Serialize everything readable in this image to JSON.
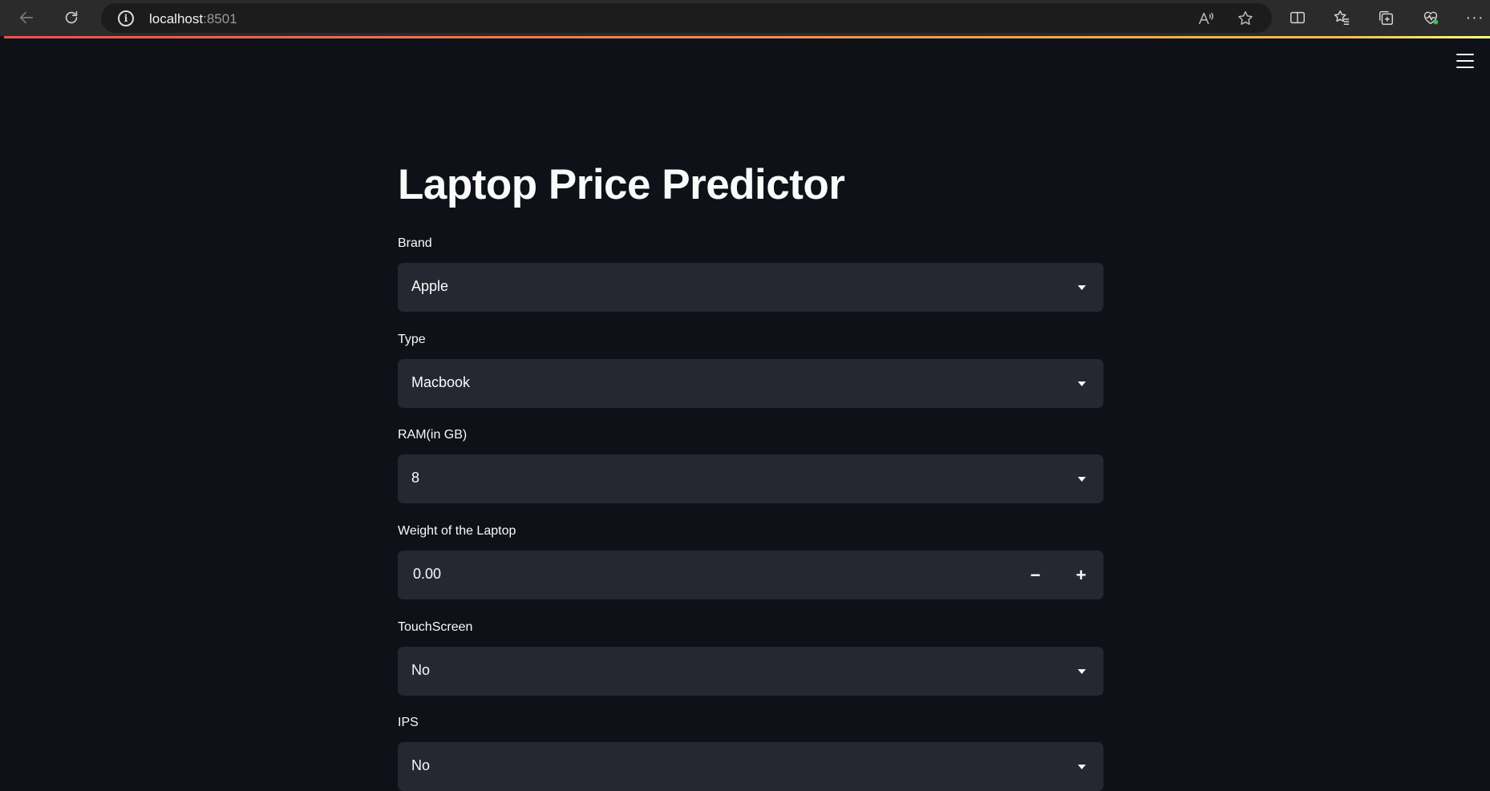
{
  "browser": {
    "url_host": "localhost",
    "url_port": ":8501",
    "read_aloud_label": "Aᴬ",
    "more_label": "···"
  },
  "app": {
    "title": "Laptop Price Predictor",
    "fields": {
      "brand": {
        "label": "Brand",
        "value": "Apple"
      },
      "type": {
        "label": "Type",
        "value": "Macbook"
      },
      "ram": {
        "label": "RAM(in GB)",
        "value": "8"
      },
      "weight": {
        "label": "Weight of the Laptop",
        "value": "0.00",
        "minus": "−",
        "plus": "+"
      },
      "touchscreen": {
        "label": "TouchScreen",
        "value": "No"
      },
      "ips": {
        "label": "IPS",
        "value": "No"
      }
    }
  },
  "colors": {
    "background": "#0e1117",
    "widget_bg": "#262730",
    "text": "#fafafa",
    "accent_gradient_start": "#ff4b4b",
    "accent_gradient_end": "#fffd80"
  },
  "icons": {
    "back": "arrow-left-icon",
    "refresh": "refresh-icon",
    "info": "info-icon",
    "favorite": "star-icon",
    "split": "split-screen-icon",
    "favorites": "favorites-icon",
    "collections": "collections-icon",
    "health": "browser-essentials-icon",
    "menu": "hamburger-menu-icon",
    "dropdown": "caret-down-icon"
  }
}
